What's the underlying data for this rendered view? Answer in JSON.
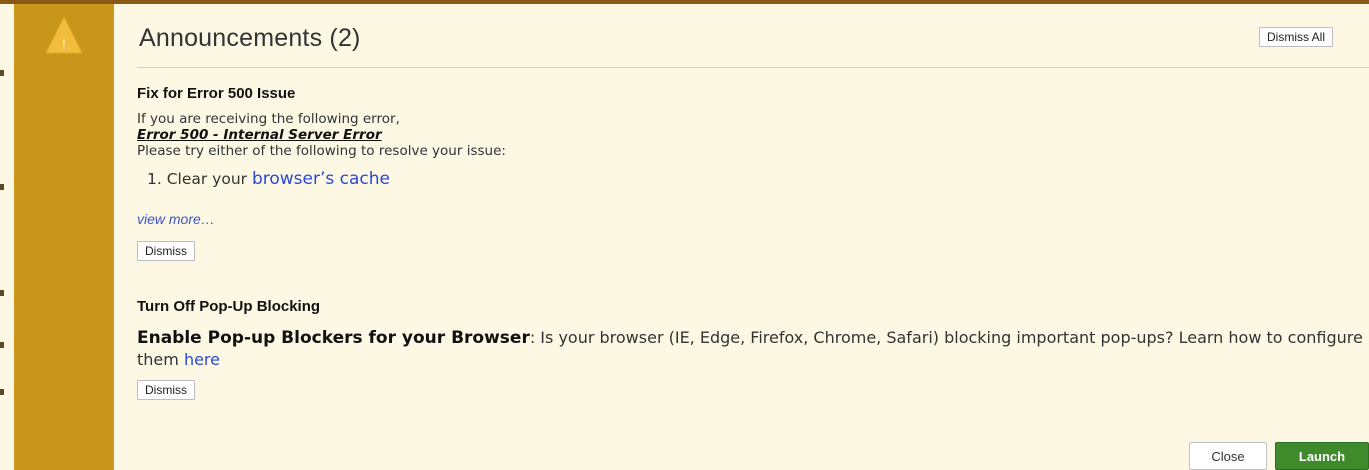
{
  "colors": {
    "accent_gold": "#c8961a",
    "panel_bg": "#fdf8e3",
    "link_blue": "#2a48d4",
    "launch_green": "#3f8b2c"
  },
  "icons": {
    "warning": "warning-triangle-icon"
  },
  "header": {
    "title": "Announcements (2)",
    "dismiss_all_label": "Dismiss All"
  },
  "announcements": [
    {
      "title": "Fix for Error 500 Issue",
      "line1": "If you are receiving the following error,",
      "error_text": "Error 500 - Internal Server Error",
      "line3": "Please try either of the following to resolve your issue:",
      "list_prefix": "1. Clear your ",
      "list_link": "browser’s cache",
      "view_more": "view more…",
      "dismiss_label": "Dismiss"
    },
    {
      "title": "Turn Off Pop-Up Blocking",
      "lead": "Enable Pop-up Blockers for your Browser",
      "body": ":  Is your browser (IE, Edge, Firefox, Chrome, Safari) blocking important pop-ups? Learn how to configure them ",
      "link": "here",
      "dismiss_label": "Dismiss"
    }
  ],
  "footer": {
    "close_label": "Close",
    "launch_label": "Launch"
  }
}
